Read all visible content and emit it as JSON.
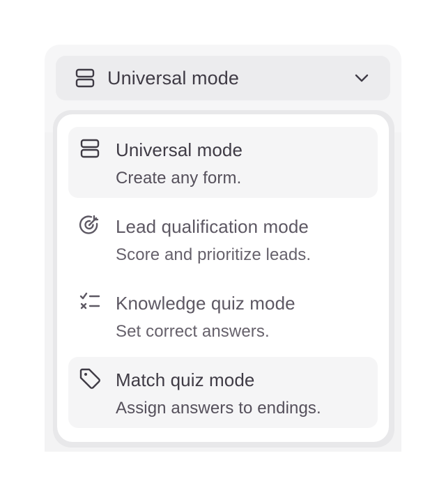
{
  "selector": {
    "icon": "rows-icon",
    "label": "Universal mode",
    "chevron": "chevron-down-icon"
  },
  "menu": {
    "items": [
      {
        "icon": "rows-icon",
        "title": "Universal mode",
        "description": "Create any form.",
        "state": "selected"
      },
      {
        "icon": "target-icon",
        "title": "Lead qualification mode",
        "description": "Score and prioritize leads.",
        "state": "normal"
      },
      {
        "icon": "checklist-icon",
        "title": "Knowledge quiz mode",
        "description": "Set correct answers.",
        "state": "normal"
      },
      {
        "icon": "tag-icon",
        "title": "Match quiz mode",
        "description": "Assign answers to endings.",
        "state": "hover"
      }
    ]
  },
  "colors": {
    "text": "#3f3b45",
    "selector_bg": "#ececee",
    "menu_bg": "#ffffff",
    "item_highlight": "#f5f5f6"
  }
}
